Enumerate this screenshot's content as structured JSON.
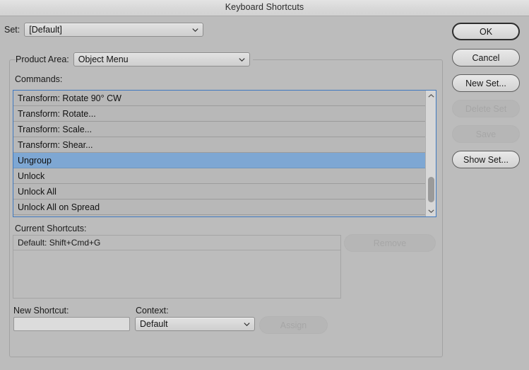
{
  "window": {
    "title": "Keyboard Shortcuts"
  },
  "set": {
    "label": "Set:",
    "value": "[Default]"
  },
  "product_area": {
    "label": "Product Area:",
    "value": "Object Menu"
  },
  "commands": {
    "label": "Commands:",
    "items": [
      {
        "label": "Transform: Rotate 90° CW",
        "selected": false
      },
      {
        "label": "Transform: Rotate...",
        "selected": false
      },
      {
        "label": "Transform: Scale...",
        "selected": false
      },
      {
        "label": "Transform: Shear...",
        "selected": false
      },
      {
        "label": "Ungroup",
        "selected": true
      },
      {
        "label": "Unlock",
        "selected": false
      },
      {
        "label": "Unlock All",
        "selected": false
      },
      {
        "label": "Unlock All on Spread",
        "selected": false
      }
    ],
    "scrollbar": {
      "up_arrow": "chevron-up-icon",
      "down_arrow": "chevron-down-icon"
    }
  },
  "current_shortcuts": {
    "label": "Current Shortcuts:",
    "items": [
      {
        "label": "Default: Shift+Cmd+G"
      }
    ],
    "remove_label": "Remove",
    "remove_enabled": false
  },
  "new_shortcut": {
    "label": "New Shortcut:",
    "value": "",
    "placeholder": ""
  },
  "context": {
    "label": "Context:",
    "value": "Default"
  },
  "assign": {
    "label": "Assign",
    "enabled": false
  },
  "buttons": [
    {
      "id": "ok",
      "label": "OK",
      "enabled": true,
      "default": true
    },
    {
      "id": "cancel",
      "label": "Cancel",
      "enabled": true,
      "default": false
    },
    {
      "id": "new_set",
      "label": "New Set...",
      "enabled": true,
      "default": false
    },
    {
      "id": "delete_set",
      "label": "Delete Set",
      "enabled": false,
      "default": false
    },
    {
      "id": "save",
      "label": "Save",
      "enabled": false,
      "default": false
    },
    {
      "id": "show_set",
      "label": "Show Set...",
      "enabled": true,
      "default": false
    }
  ],
  "colors": {
    "window_bg": "#bcbcbc",
    "titlebar_bg": "#d8d8d8",
    "selection_blue": "#7ea7d3",
    "focus_border": "#3f79c0",
    "row_bg": "#b8b8b8",
    "disabled_text": "#a6a6a6"
  }
}
